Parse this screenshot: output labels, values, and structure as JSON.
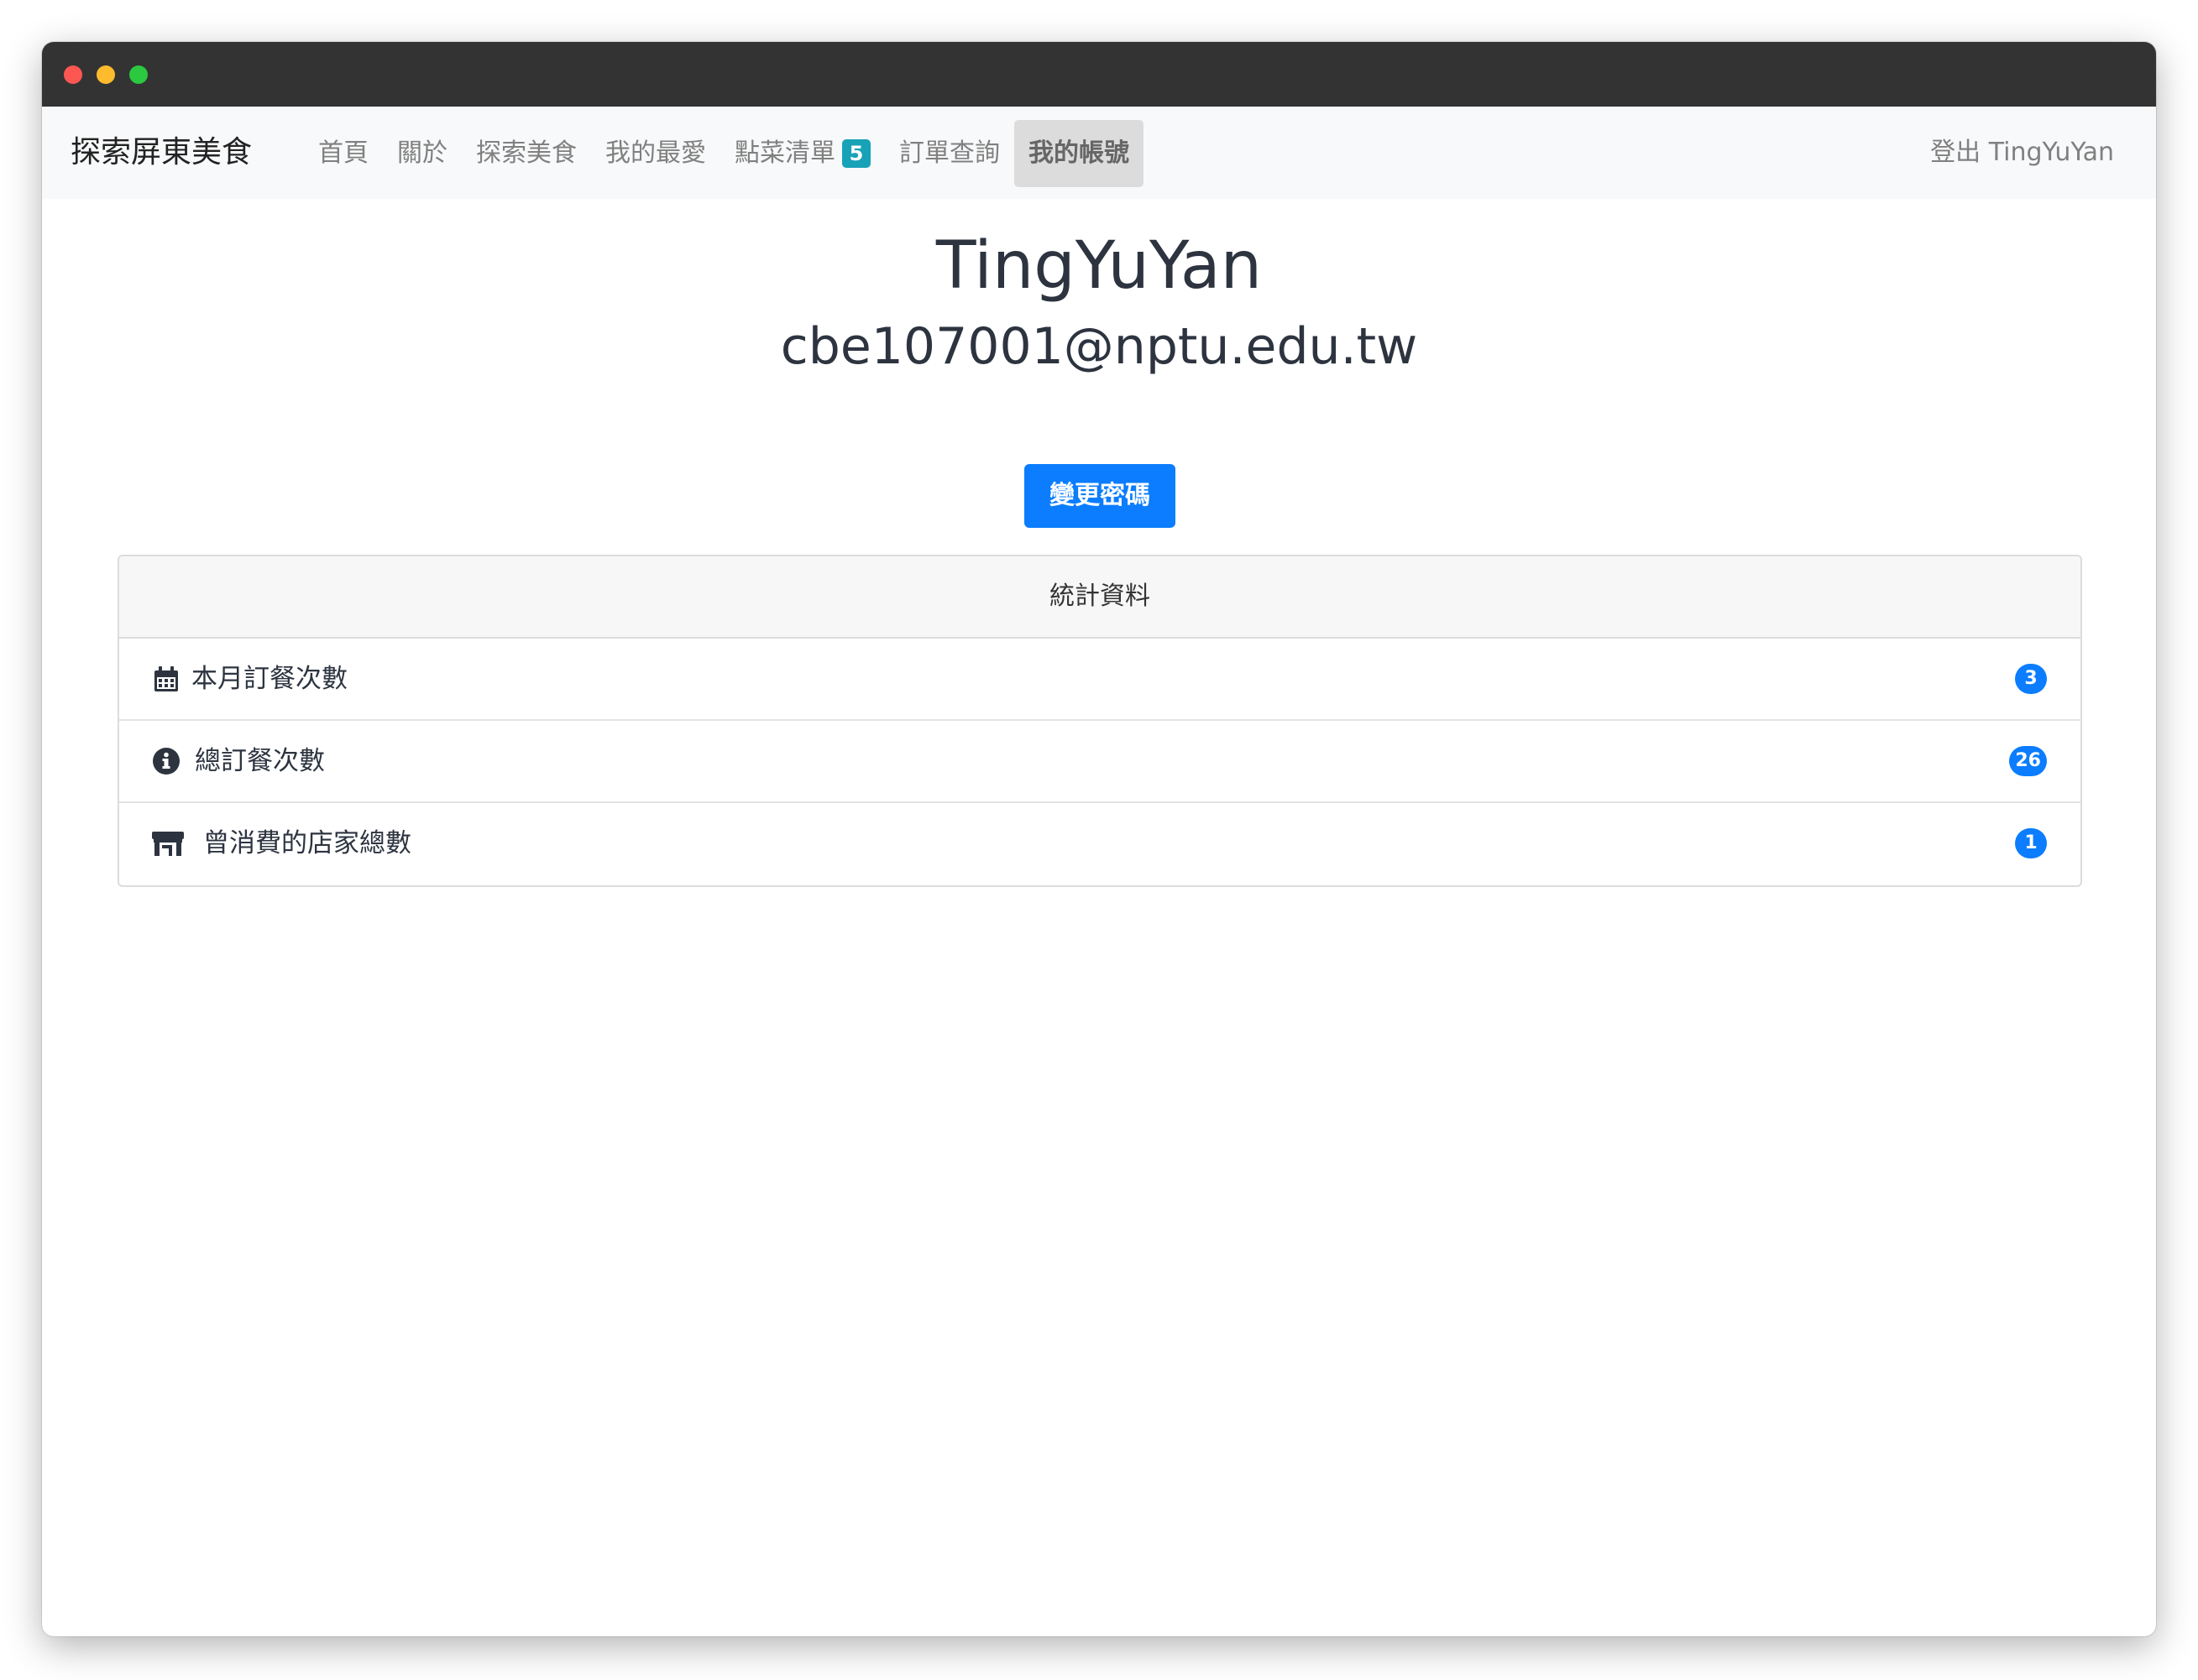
{
  "window": {
    "controls": [
      "close",
      "minimize",
      "zoom"
    ]
  },
  "navbar": {
    "brand": "探索屏東美食",
    "items": [
      {
        "label": "首頁"
      },
      {
        "label": "關於"
      },
      {
        "label": "探索美食"
      },
      {
        "label": "我的最愛"
      },
      {
        "label": "點菜清單",
        "badge": "5"
      },
      {
        "label": "訂單查詢"
      },
      {
        "label": "我的帳號",
        "active": true
      }
    ],
    "logout": "登出 TingYuYan"
  },
  "profile": {
    "username": "TingYuYan",
    "email": "cbe107001@nptu.edu.tw",
    "change_password_label": "變更密碼"
  },
  "stats": {
    "header": "統計資料",
    "items": [
      {
        "icon": "calendar-icon",
        "label": "本月訂餐次數",
        "count": "3"
      },
      {
        "icon": "info-circle-icon",
        "label": "總訂餐次數",
        "count": "26"
      },
      {
        "icon": "store-icon",
        "label": "曾消費的店家總數",
        "count": "1"
      }
    ]
  },
  "colors": {
    "primary": "#0b7dfe",
    "info_badge": "#17a2b8",
    "titlebar": "#333333",
    "navbar_bg": "#f8f9fa"
  }
}
